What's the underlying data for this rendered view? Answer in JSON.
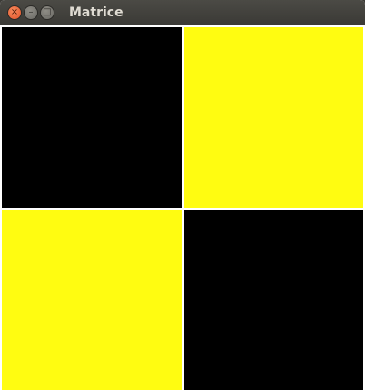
{
  "window": {
    "title": "Matrice",
    "buttons": {
      "close_glyph": "×",
      "minimize_glyph": "–",
      "maximize_glyph": "□"
    }
  },
  "matrix": {
    "rows": 2,
    "cols": 2,
    "cells": [
      [
        "black",
        "yellow"
      ],
      [
        "yellow",
        "black"
      ]
    ]
  },
  "colors": {
    "black": "#000000",
    "yellow": "#fffc11",
    "grid_line": "#ffffff"
  }
}
